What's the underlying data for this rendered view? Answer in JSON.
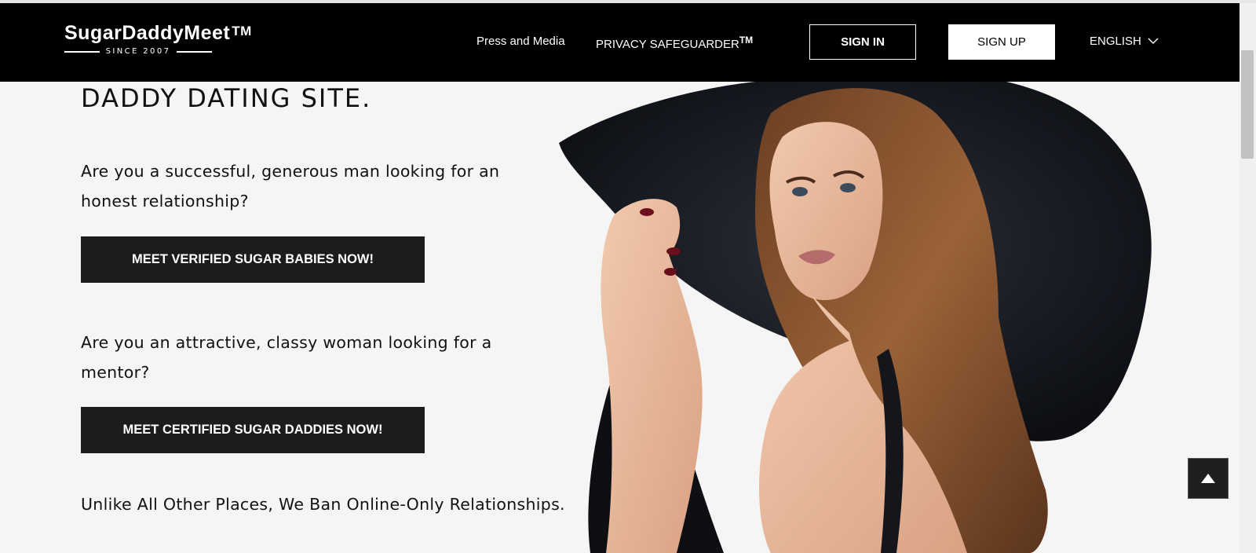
{
  "header": {
    "logo_text": "SugarDaddyMeet",
    "logo_tm": "TM",
    "logo_since": "SINCE 2007",
    "nav": {
      "press": "Press and Media",
      "privacy": "PRIVACY SAFEGUARDER",
      "privacy_tm": "TM"
    },
    "sign_in": "SIGN IN",
    "sign_up": "SIGN UP",
    "language": "ENGLISH"
  },
  "main": {
    "headline": "DADDY DATING SITE.",
    "question_men": "Are you a successful, generous man looking for an honest relationship?",
    "cta_babies": "MEET VERIFIED SUGAR BABIES NOW!",
    "question_women": "Are you an attractive, classy woman looking for a mentor?",
    "cta_daddies": "MEET CERTIFIED SUGAR DADDIES NOW!",
    "tagline": "Unlike All Other Places, We Ban Online-Only Relationships."
  },
  "colors": {
    "header_bg": "#000000",
    "page_bg": "#f5f5f5",
    "button_dark": "#1c1c1c"
  }
}
